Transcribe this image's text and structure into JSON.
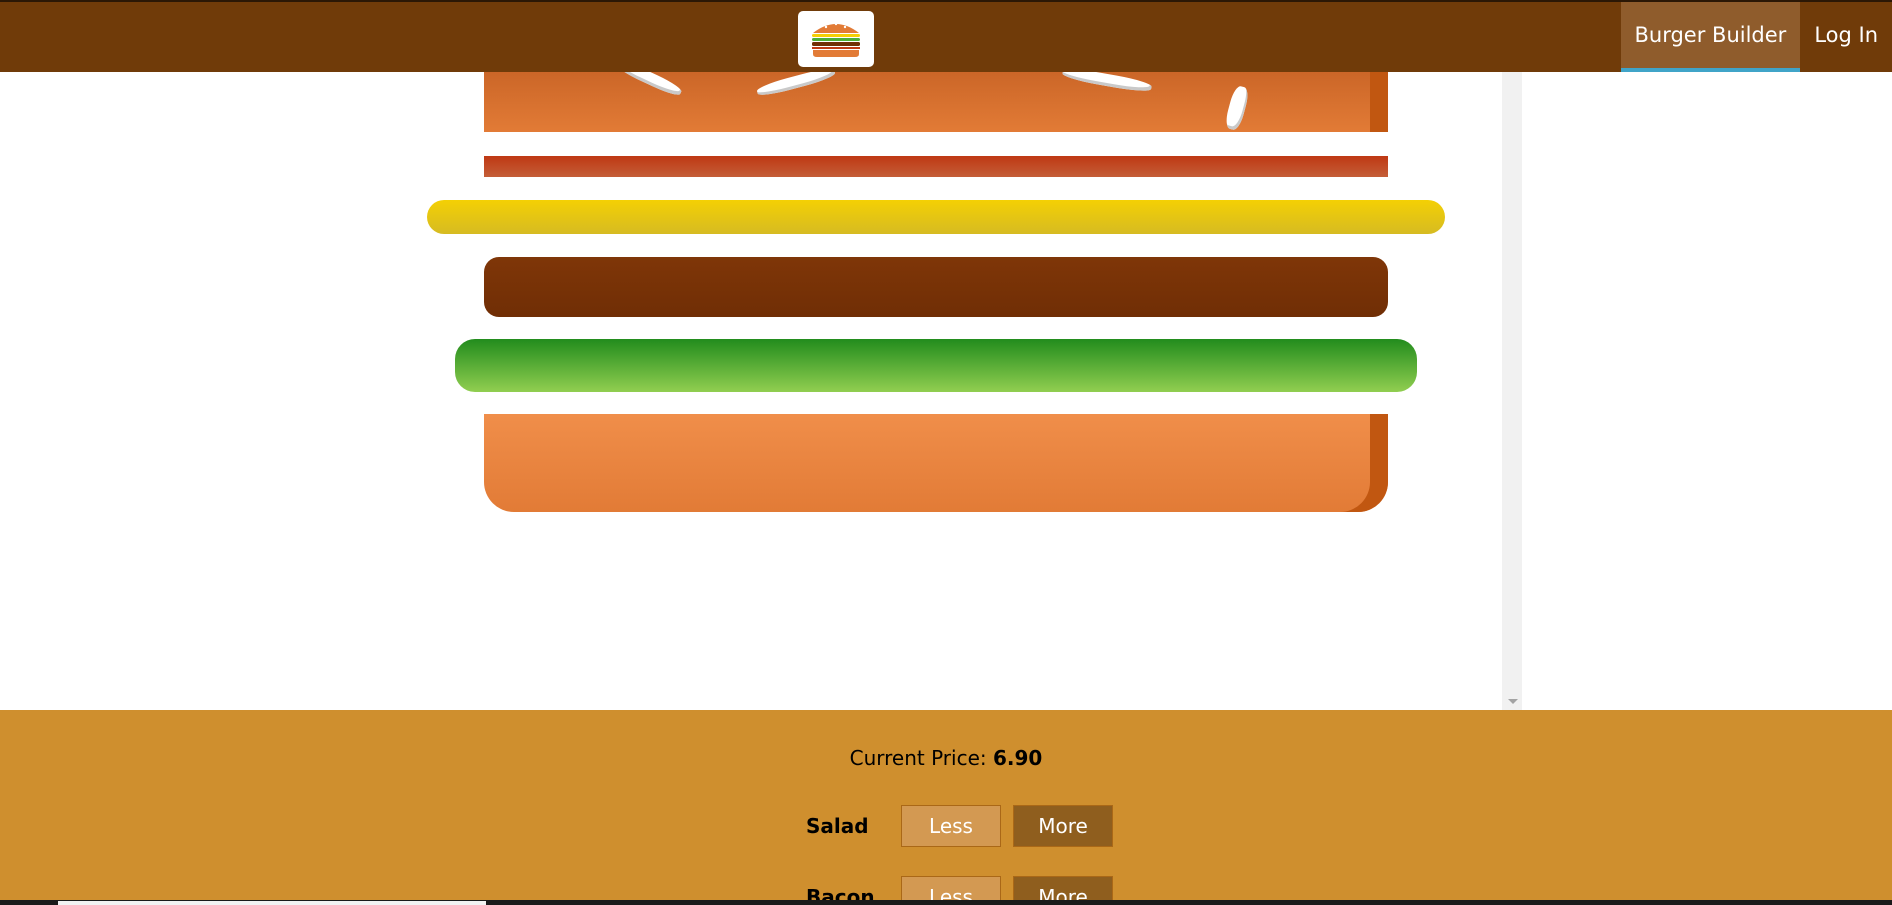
{
  "toolbar": {
    "nav_items": [
      {
        "label": "Burger Builder",
        "active": true
      },
      {
        "label": "Log In",
        "active": false
      }
    ]
  },
  "burger": {
    "ingredients_visible": [
      "bread-top",
      "bacon",
      "cheese",
      "meat",
      "salad",
      "bread-bottom"
    ]
  },
  "controls": {
    "price_label": "Current Price:",
    "price_value": "6.90",
    "rows": [
      {
        "label": "Salad",
        "less": "Less",
        "more": "More"
      },
      {
        "label": "Bacon",
        "less": "Less",
        "more": "More"
      }
    ]
  },
  "colors": {
    "toolbar": "#703B09",
    "controls_bg": "#CF8F2E",
    "active_underline": "#40A4C8"
  }
}
